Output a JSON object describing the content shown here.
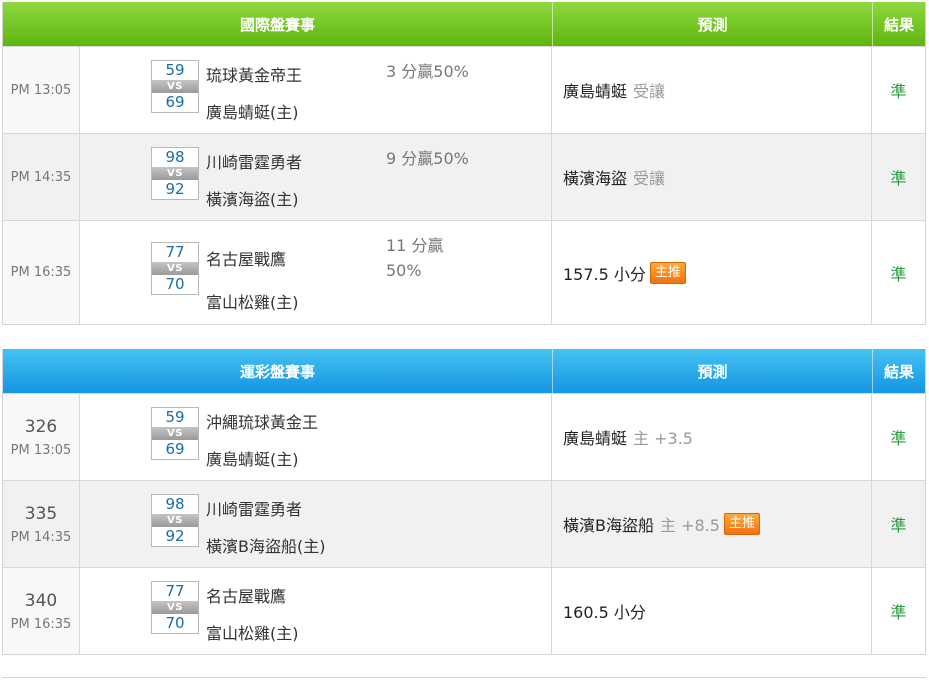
{
  "intl": {
    "header": {
      "match": "國際盤賽事",
      "prediction": "預測",
      "result": "結果"
    },
    "rows": [
      {
        "time": "PM 13:05",
        "away": "琉球黃金帝王",
        "home": "廣島蜻蜓(主)",
        "away_score": "59",
        "home_score": "69",
        "vs": "VS",
        "spread": "3 分贏50%",
        "pred_team": "廣島蜻蜓",
        "pred_note": "受讓",
        "result": "準"
      },
      {
        "time": "PM 14:35",
        "away": "川崎雷霆勇者",
        "home": "橫濱海盜(主)",
        "away_score": "98",
        "home_score": "92",
        "vs": "VS",
        "spread": "9 分贏50%",
        "pred_team": "橫濱海盜",
        "pred_note": "受讓",
        "result": "準"
      },
      {
        "time": "PM 16:35",
        "away": "名古屋戰鷹",
        "home": "富山松雞(主)",
        "away_score": "77",
        "home_score": "70",
        "vs": "VS",
        "spread_l1": "11 分贏",
        "spread_l2": "50%",
        "pred_team": "157.5 小分",
        "badge": "主推",
        "result": "準"
      }
    ]
  },
  "lottery": {
    "header": {
      "match": "運彩盤賽事",
      "prediction": "預測",
      "result": "結果"
    },
    "rows": [
      {
        "code": "326",
        "time": "PM 13:05",
        "away": "沖繩琉球黃金王",
        "home": "廣島蜻蜓(主)",
        "away_score": "59",
        "home_score": "69",
        "vs": "VS",
        "pred_team": "廣島蜻蜓",
        "pred_note": "主 +3.5",
        "result": "準"
      },
      {
        "code": "335",
        "time": "PM 14:35",
        "away": "川崎雷霆勇者",
        "home": "橫濱B海盜船(主)",
        "away_score": "98",
        "home_score": "92",
        "vs": "VS",
        "pred_team": "橫濱B海盜船",
        "pred_note": "主 +8.5",
        "badge": "主推",
        "result": "準"
      },
      {
        "code": "340",
        "time": "PM 16:35",
        "away": "名古屋戰鷹",
        "home": "富山松雞(主)",
        "away_score": "77",
        "home_score": "70",
        "vs": "VS",
        "pred_team": "160.5 小分",
        "result": "準"
      }
    ]
  },
  "colors": {
    "green_header": "#6cc11e",
    "blue_header": "#24a6e8",
    "result_green": "#2a9b3c",
    "score_blue": "#1a6ca8",
    "badge_orange": "#f58a1f"
  }
}
